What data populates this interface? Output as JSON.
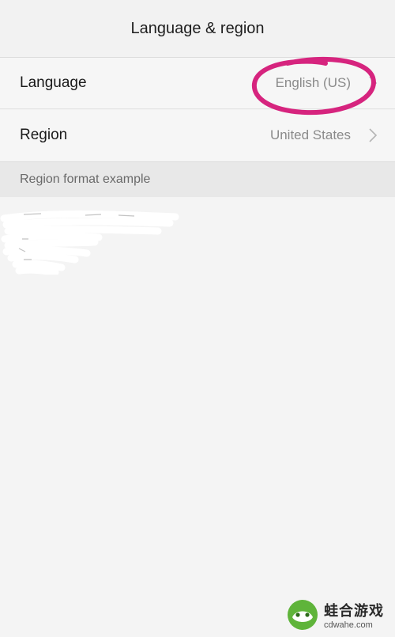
{
  "header": {
    "title": "Language & region"
  },
  "settings": {
    "rows": [
      {
        "label": "Language",
        "value": "English (US)",
        "icon": "chevron-right-icon"
      },
      {
        "label": "Region",
        "value": "United States",
        "icon": "chevron-right-icon"
      }
    ]
  },
  "example_section": {
    "title": "Region format example"
  },
  "annotation": {
    "circle_color": "#d6247e"
  },
  "watermark": {
    "name": "蛙合游戏",
    "url": "cdwahe.com",
    "logo_icon": "frog-logo-icon"
  },
  "colors": {
    "background": "#f3f3f3",
    "section_header_bg": "#e8e8e8",
    "value_text": "#8a8a8a"
  }
}
